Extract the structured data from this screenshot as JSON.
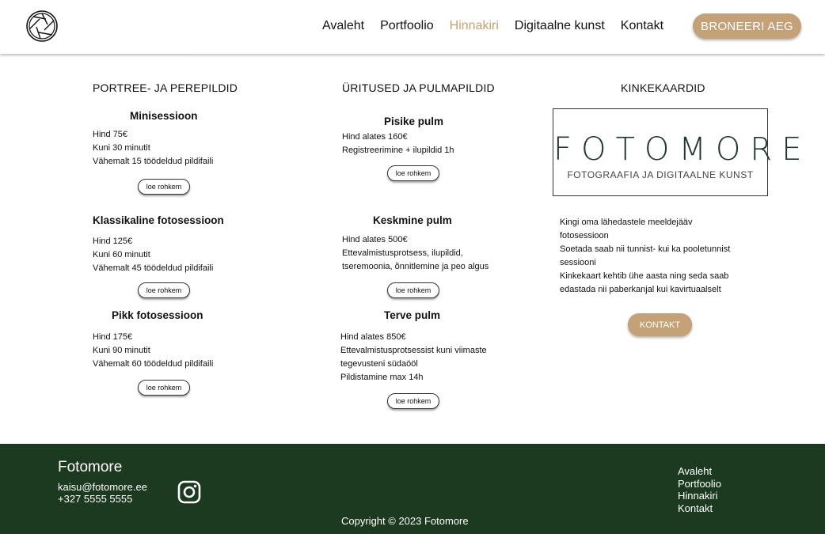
{
  "header": {
    "logo_icon": "aperture-logo-icon",
    "nav": [
      "Avaleht",
      "Portfoolio",
      "Hinnakiri",
      "Digitaalne kunst",
      "Kontakt"
    ],
    "active_nav": "Hinnakiri",
    "book_button": "BRONEERI AEG",
    "accent_color": "#c4a176"
  },
  "columns": {
    "portrait": {
      "title": "PORTREE- JA PEREPILDID",
      "packages": [
        {
          "name": "Minisessioon",
          "lines": [
            "Hind 75€",
            "Kuni 30 minutit",
            "Vähemalt 15 töödeldud pildifaili"
          ],
          "more": "loe rohkem"
        },
        {
          "name": "Klassikaline fotosessioon",
          "lines": [
            "Hind 125€",
            "Kuni 60 minutit",
            "Vähemalt 45 töödeldud pildifaili"
          ],
          "more": "loe rohkem"
        },
        {
          "name": "Pikk fotosessioon",
          "lines": [
            "Hind 175€",
            "Kuni 90 minutit",
            "Vähemalt 60 töödeldud pildifaili"
          ],
          "more": "loe rohkem"
        }
      ]
    },
    "events": {
      "title": "ÜRITUSED JA PULMAPILDID",
      "packages": [
        {
          "name": "Pisike pulm",
          "lines": [
            "Hind alates 160€",
            "Registreerimine + ilupildid 1h"
          ],
          "more": "loe rohkem"
        },
        {
          "name": "Keskmine pulm",
          "lines": [
            "Hind alates 500€",
            "Ettevalmistusprotsess, ilupildid,",
            "tseremoonia, õnnitlemine ja peo algus"
          ],
          "more": "loe rohkem"
        },
        {
          "name": "Terve pulm",
          "lines": [
            "Hind alates 850€",
            "Ettevalmistusprotsessist kuni viimaste",
            "tegevusteni südaööl",
            "Pildistamine max 14h"
          ],
          "more": "loe rohkem"
        }
      ]
    },
    "gift": {
      "title": "KINKEKAARDID",
      "card_brand": "FOTOMORE",
      "card_subtitle": "FOTOGRAAFIA JA DIGITAALNE KUNST",
      "lines": [
        "Kingi oma lähedastele meeldejääv",
        "fotosessioon",
        "Soetada saab nii tunnist- kui ka pooletunnist",
        "sessiooni",
        "Kinkekaart kehtib ühe aasta ning seda saab",
        "edastada nii paberkanjal kui kavirtuaalselt"
      ],
      "contact_button": "KONTAKT"
    }
  },
  "footer": {
    "brand": "Fotomore",
    "email": "kaisu@fotomore.ee",
    "phone": "+327 5555 5555",
    "social_icon": "instagram-icon",
    "copyright": "Copyright © 2023 Fotomore",
    "links": [
      "Avaleht",
      "Portfoolio",
      "Hinnakiri",
      "Kontakt"
    ],
    "background_color": "#1b3a1f"
  }
}
